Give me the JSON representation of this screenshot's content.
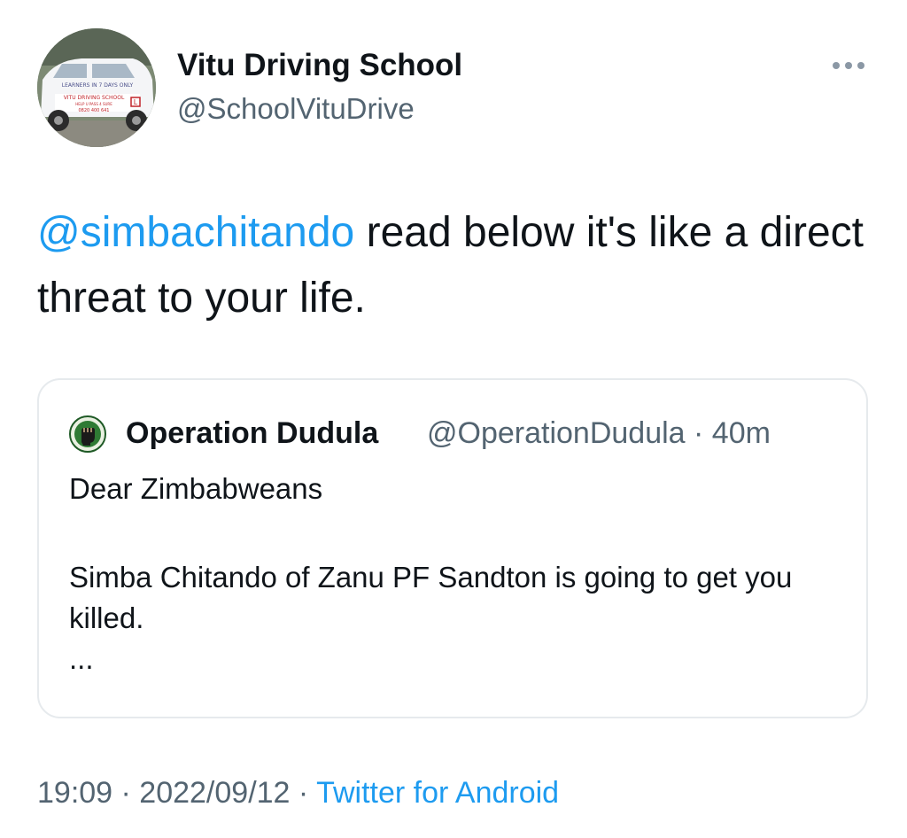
{
  "author": {
    "display_name": "Vitu Driving School",
    "handle": "@SchoolVituDrive",
    "avatar": {
      "icon": "driving-school-car-avatar",
      "signage": [
        "LEARNERS IN 7 DAYS ONLY",
        "VITU DRIVING SCHOOL",
        "HELP U PASS 4 SURE",
        "0820 400 641"
      ]
    }
  },
  "more_menu": {
    "icon": "more-options-icon"
  },
  "tweet": {
    "mention": "@simbachitando",
    "text": " read below it's like a direct threat to your life."
  },
  "quoted_tweet": {
    "avatar_icon": "fist-logo-icon",
    "display_name": "Operation Dudula",
    "handle_time": "@OperationDudula · 40m",
    "line1": "Dear Zimbabweans",
    "line2": "Simba Chitando of Zanu PF Sandton is going to get you killed.",
    "ellipsis": "..."
  },
  "footer": {
    "time_date": "19:09 · 2022/09/12 · ",
    "source": "Twitter for Android"
  },
  "colors": {
    "link": "#1d9bf0",
    "secondary_text": "#536471",
    "border": "#e6eaed"
  }
}
